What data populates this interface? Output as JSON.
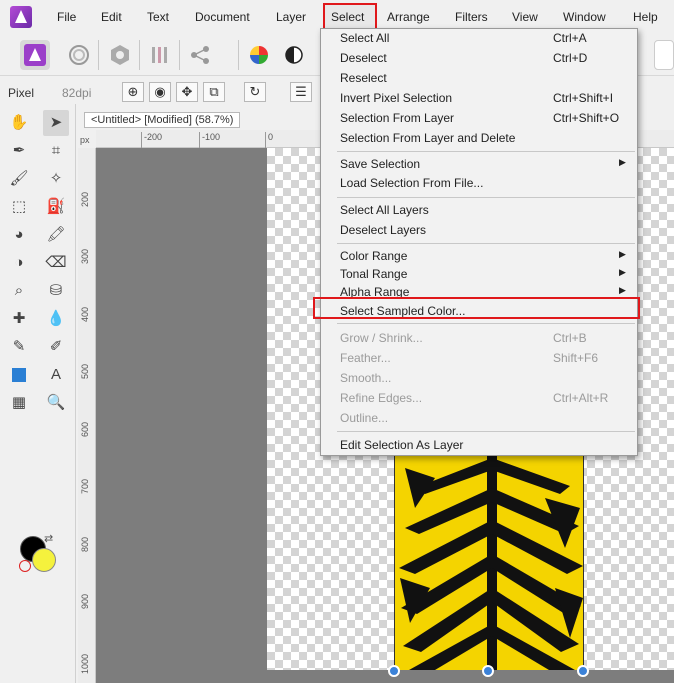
{
  "menubar": {
    "items": [
      "File",
      "Edit",
      "Text",
      "Document",
      "Layer",
      "Select",
      "Arrange",
      "Filters",
      "View",
      "Window",
      "Help"
    ]
  },
  "context": {
    "mode": "Pixel",
    "dpi": "82dpi"
  },
  "document": {
    "tab_title": "<Untitled> [Modified] (58.7%)"
  },
  "ruler": {
    "unit": "px",
    "h_ticks": [
      "-200",
      "-100",
      "0"
    ],
    "v_ticks": [
      "200",
      "300",
      "400",
      "500",
      "600",
      "700",
      "800",
      "900",
      "1000"
    ]
  },
  "select_menu": {
    "select_all": "Select All",
    "select_all_sc": "Ctrl+A",
    "deselect": "Deselect",
    "deselect_sc": "Ctrl+D",
    "reselect": "Reselect",
    "invert": "Invert Pixel Selection",
    "invert_sc": "Ctrl+Shift+I",
    "from_layer": "Selection From Layer",
    "from_layer_sc": "Ctrl+Shift+O",
    "from_layer_delete": "Selection From Layer and Delete",
    "save_selection": "Save Selection",
    "load_selection": "Load Selection From File...",
    "select_all_layers": "Select All Layers",
    "deselect_layers": "Deselect Layers",
    "color_range": "Color Range",
    "tonal_range": "Tonal Range",
    "alpha_range": "Alpha Range",
    "select_sampled": "Select Sampled Color...",
    "grow_shrink": "Grow / Shrink...",
    "grow_shrink_sc": "Ctrl+B",
    "feather": "Feather...",
    "feather_sc": "Shift+F6",
    "smooth": "Smooth...",
    "refine": "Refine Edges...",
    "refine_sc": "Ctrl+Alt+R",
    "outline": "Outline...",
    "edit_as_layer": "Edit Selection As Layer"
  },
  "colors": {
    "foreground": "#000000",
    "background": "#f5f23d",
    "accent": "#e0181b"
  }
}
